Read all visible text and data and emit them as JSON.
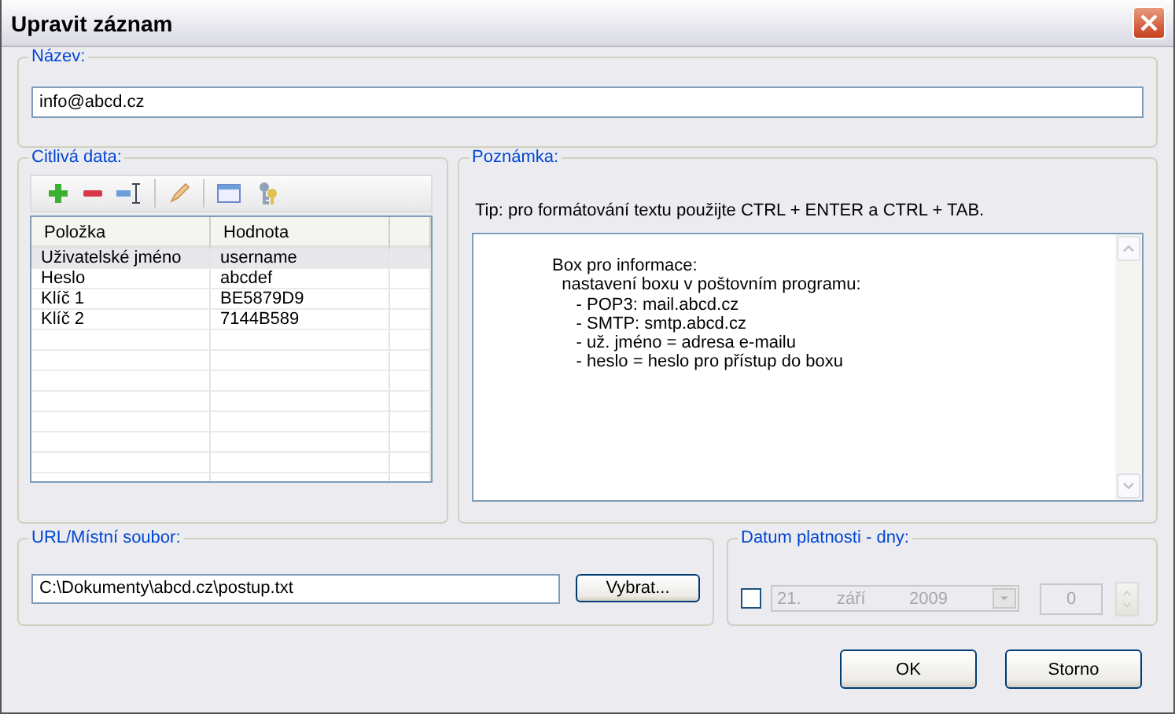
{
  "window": {
    "title": "Upravit záznam"
  },
  "name_group": {
    "label": "Název:",
    "value": "info@abcd.cz"
  },
  "sensitive": {
    "label": "Citlivá data:",
    "columns": [
      "Položka",
      "Hodnota"
    ],
    "rows": [
      {
        "cells": [
          "Uživatelské jméno",
          "username"
        ],
        "selected": true
      },
      {
        "cells": [
          "Heslo",
          "abcdef"
        ],
        "selected": false
      },
      {
        "cells": [
          "Klíč 1",
          "BE5879D9"
        ],
        "selected": false
      },
      {
        "cells": [
          "Klíč 2",
          "7144B589"
        ],
        "selected": false
      }
    ]
  },
  "note": {
    "label": "Poznámka:",
    "tip": "Tip: pro formátování textu použijte CTRL + ENTER a CTRL + TAB.",
    "text": "Box pro informace:\n  nastavení boxu v poštovním programu:\n     - POP3: mail.abcd.cz\n     - SMTP: smtp.abcd.cz\n     - už. jméno = adresa e-mailu\n     - heslo = heslo pro přístup do boxu"
  },
  "file": {
    "label": "URL/Místní soubor:",
    "value": "C:\\Dokumenty\\abcd.cz\\postup.txt",
    "button": "Vybrat..."
  },
  "expiry": {
    "label": "Datum platnosti - dny:",
    "checked": false,
    "disabled": true,
    "day": "21.",
    "month": "září",
    "year": "2009",
    "days": "0"
  },
  "buttons": [
    "OK",
    "Storno"
  ]
}
